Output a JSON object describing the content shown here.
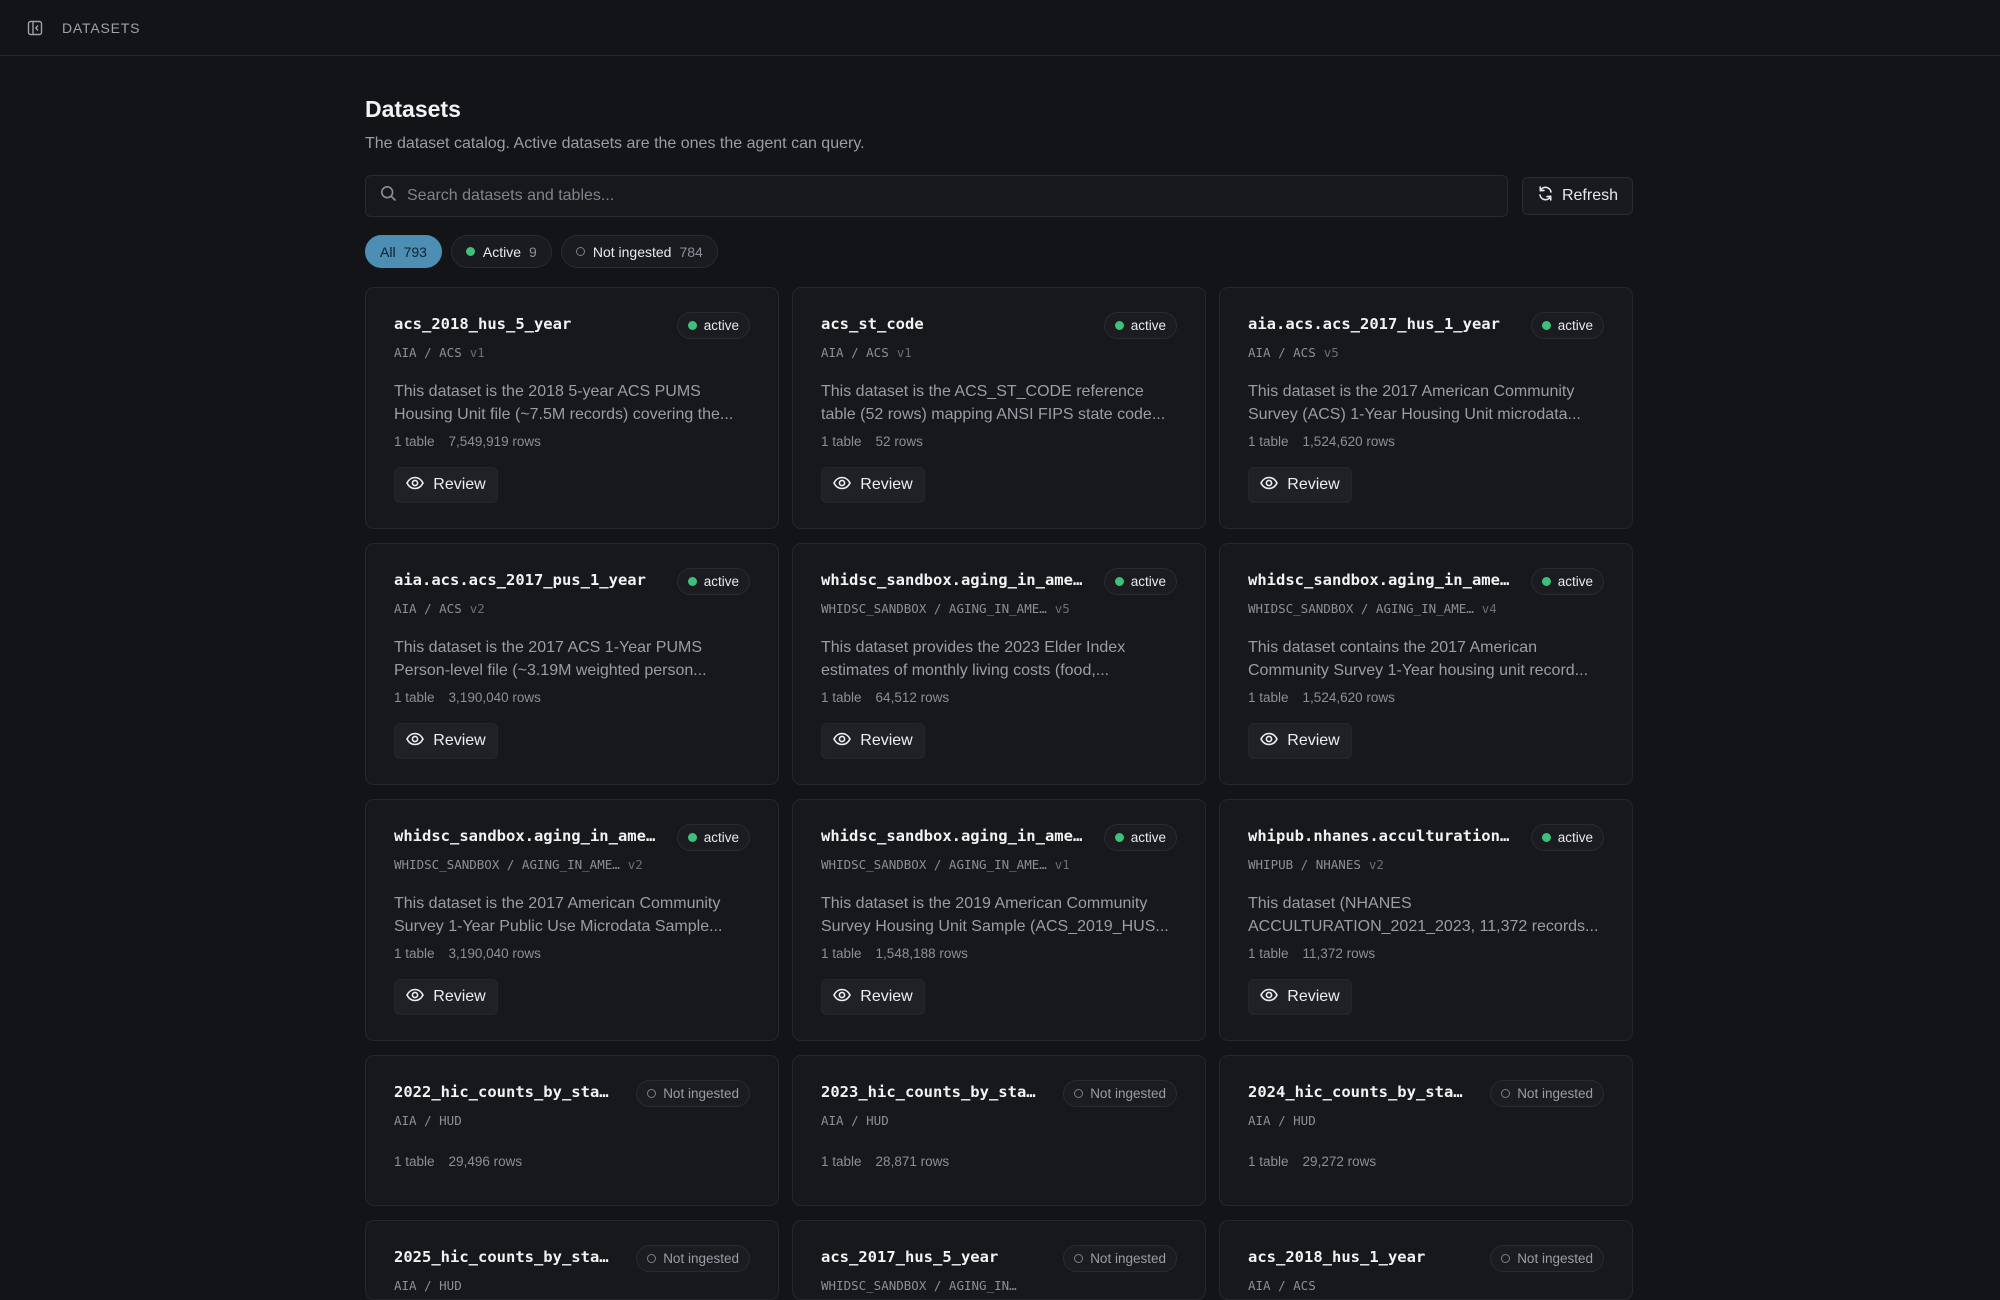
{
  "topbar": {
    "breadcrumb": "DATASETS"
  },
  "page": {
    "title": "Datasets",
    "description": "The dataset catalog. Active datasets are the ones the agent can query."
  },
  "search": {
    "placeholder": "Search datasets and tables...",
    "value": ""
  },
  "refresh_label": "Refresh",
  "filters": [
    {
      "label": "All",
      "count": "793"
    },
    {
      "label": "Active",
      "count": "9"
    },
    {
      "label": "Not ingested",
      "count": "784"
    }
  ],
  "review_label": "Review",
  "datasets": [
    {
      "name": "acs_2018_hus_5_year",
      "path": "AIA / ACS",
      "version": "v1",
      "status": "active",
      "desc1": "This dataset is the 2018 5-year ACS PUMS",
      "desc2": "Housing Unit file (~7.5M records) covering the...",
      "tables": "1 table",
      "rows": "7,549,919 rows"
    },
    {
      "name": "acs_st_code",
      "path": "AIA / ACS",
      "version": "v1",
      "status": "active",
      "desc1": "This dataset is the ACS_ST_CODE reference",
      "desc2": "table (52 rows) mapping ANSI FIPS state code...",
      "tables": "1 table",
      "rows": "52 rows"
    },
    {
      "name": "aia.acs.acs_2017_hus_1_year",
      "path": "AIA / ACS",
      "version": "v5",
      "status": "active",
      "desc1": "This dataset is the 2017 American Community",
      "desc2": "Survey (ACS) 1-Year Housing Unit microdata...",
      "tables": "1 table",
      "rows": "1,524,620 rows"
    },
    {
      "name": "aia.acs.acs_2017_pus_1_year",
      "path": "AIA / ACS",
      "version": "v2",
      "status": "active",
      "desc1": "This dataset is the 2017 ACS 1-Year PUMS",
      "desc2": "Person-level file (~3.19M weighted person...",
      "tables": "1 table",
      "rows": "3,190,040 rows"
    },
    {
      "name": "whidsc_sandbox.aging_in_ame…",
      "path": "WHIDSC_SANDBOX / AGING_IN_AME…",
      "version": "v5",
      "status": "active",
      "desc1": "This dataset provides the 2023 Elder Index",
      "desc2": "estimates of monthly living costs (food,...",
      "tables": "1 table",
      "rows": "64,512 rows"
    },
    {
      "name": "whidsc_sandbox.aging_in_ame…",
      "path": "WHIDSC_SANDBOX / AGING_IN_AME…",
      "version": "v4",
      "status": "active",
      "desc1": "This dataset contains the 2017 American",
      "desc2": "Community Survey 1-Year housing unit record...",
      "tables": "1 table",
      "rows": "1,524,620 rows"
    },
    {
      "name": "whidsc_sandbox.aging_in_ame…",
      "path": "WHIDSC_SANDBOX / AGING_IN_AME…",
      "version": "v2",
      "status": "active",
      "desc1": "This dataset is the 2017 American Community",
      "desc2": "Survey 1-Year Public Use Microdata Sample...",
      "tables": "1 table",
      "rows": "3,190,040 rows"
    },
    {
      "name": "whidsc_sandbox.aging_in_ame…",
      "path": "WHIDSC_SANDBOX / AGING_IN_AME…",
      "version": "v1",
      "status": "active",
      "desc1": "This dataset is the 2019 American Community",
      "desc2": "Survey Housing Unit Sample (ACS_2019_HUS...",
      "tables": "1 table",
      "rows": "1,548,188 rows"
    },
    {
      "name": "whipub.nhanes.acculturation…",
      "path": "WHIPUB / NHANES",
      "version": "v2",
      "status": "active",
      "desc1": "This dataset (NHANES",
      "desc2": "ACCULTURATION_2021_2023, 11,372 records...",
      "tables": "1 table",
      "rows": "11,372 rows"
    },
    {
      "name": "2022_hic_counts_by_sta…",
      "path": "AIA / HUD",
      "status": "Not ingested",
      "tables": "1 table",
      "rows": "29,496 rows"
    },
    {
      "name": "2023_hic_counts_by_sta…",
      "path": "AIA / HUD",
      "status": "Not ingested",
      "tables": "1 table",
      "rows": "28,871 rows"
    },
    {
      "name": "2024_hic_counts_by_sta…",
      "path": "AIA / HUD",
      "status": "Not ingested",
      "tables": "1 table",
      "rows": "29,272 rows"
    },
    {
      "name": "2025_hic_counts_by_sta…",
      "path": "AIA / HUD",
      "status": "Not ingested"
    },
    {
      "name": "acs_2017_hus_5_year",
      "path": "WHIDSC_SANDBOX / AGING_IN…",
      "status": "Not ingested"
    },
    {
      "name": "acs_2018_hus_1_year",
      "path": "AIA / ACS",
      "status": "Not ingested"
    }
  ]
}
